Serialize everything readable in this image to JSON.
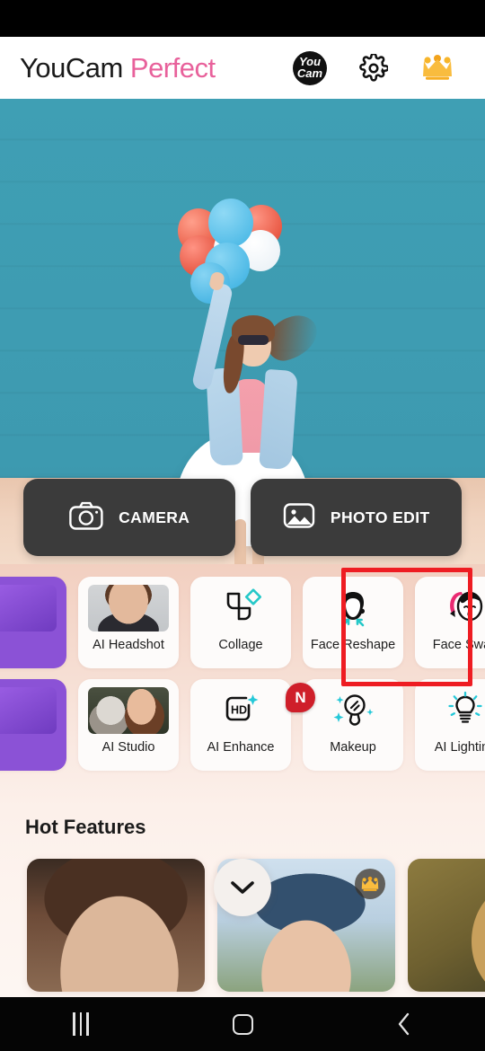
{
  "app": {
    "brand_primary": "YouCam",
    "brand_secondary": "Perfect",
    "brand_primary_color": "#1a1a1a",
    "brand_secondary_color": "#e8619b"
  },
  "header": {
    "youcam_badge_top": "You",
    "youcam_badge_bottom": "Cam",
    "icons": [
      {
        "name": "youcam-logo-badge",
        "label": "YouCam"
      },
      {
        "name": "settings-gear-icon",
        "label": "Settings"
      },
      {
        "name": "premium-crown-icon",
        "label": "Premium"
      }
    ]
  },
  "actions": [
    {
      "id": "camera",
      "label": "CAMERA",
      "icon": "camera-icon"
    },
    {
      "id": "photo-edit",
      "label": "PHOTO EDIT",
      "icon": "image-icon"
    }
  ],
  "features": {
    "row1": [
      {
        "id": "partial-left-1",
        "label": "",
        "icon": "partial-card",
        "partial": true
      },
      {
        "id": "ai-headshot",
        "label": "AI Headshot",
        "icon": "headshot-thumb"
      },
      {
        "id": "collage",
        "label": "Collage",
        "icon": "collage-icon"
      },
      {
        "id": "face-reshape",
        "label": "Face Reshape",
        "icon": "face-reshape-icon"
      },
      {
        "id": "face-swap",
        "label": "Face Swap",
        "icon": "face-swap-icon",
        "highlighted": true
      }
    ],
    "row2": [
      {
        "id": "partial-left-2",
        "label": "",
        "icon": "partial-card",
        "partial": true
      },
      {
        "id": "ai-studio",
        "label": "AI Studio",
        "icon": "ai-studio-thumb"
      },
      {
        "id": "ai-enhance",
        "label": "AI Enhance",
        "icon": "hd-icon"
      },
      {
        "id": "makeup",
        "label": "Makeup",
        "icon": "makeup-mirror-icon",
        "badge": "N"
      },
      {
        "id": "ai-lighting",
        "label": "AI Lighting",
        "icon": "lightbulb-icon"
      }
    ],
    "new_badge_text": "N",
    "highlight_color": "#ee1c22"
  },
  "hot_features": {
    "title": "Hot Features",
    "cards": [
      {
        "id": "hot-card-1",
        "premium": false
      },
      {
        "id": "hot-card-2",
        "premium": true
      },
      {
        "id": "hot-card-3",
        "premium": false
      }
    ],
    "expand_icon": "chevron-down-icon"
  },
  "navbar": [
    {
      "id": "recents",
      "icon": "recents-icon"
    },
    {
      "id": "home",
      "icon": "home-icon"
    },
    {
      "id": "back",
      "icon": "back-chevron-icon"
    }
  ]
}
